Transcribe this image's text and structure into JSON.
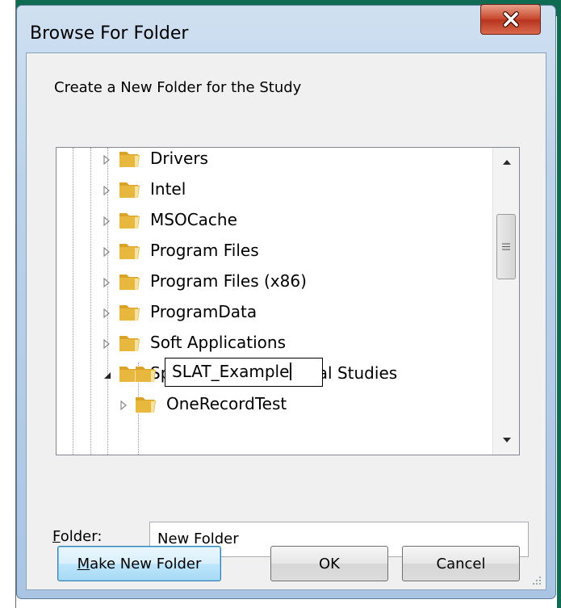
{
  "dialog": {
    "title": "Browse For Folder",
    "prompt": "Create a New Folder for the Study"
  },
  "tree": {
    "items": [
      {
        "label": "Drivers",
        "expander": "collapsed"
      },
      {
        "label": "Intel",
        "expander": "collapsed"
      },
      {
        "label": "MSOCache",
        "expander": "collapsed"
      },
      {
        "label": "Program Files",
        "expander": "collapsed"
      },
      {
        "label": "Program Files (x86)",
        "expander": "collapsed"
      },
      {
        "label": "ProgramData",
        "expander": "collapsed"
      },
      {
        "label": "Soft Applications",
        "expander": "collapsed"
      },
      {
        "label": "Speed_Limit_Appraisal Studies",
        "expander": "expanded"
      },
      {
        "label": "SLAT_Example",
        "expander": "none",
        "editing": true
      },
      {
        "label": "OneRecordTest",
        "expander": "collapsed"
      }
    ]
  },
  "folder": {
    "label_prefix": "F",
    "label_rest": "older:",
    "value": "New Folder"
  },
  "buttons": {
    "make_new_prefix": "M",
    "make_new_rest": "ake New Folder",
    "ok": "OK",
    "cancel": "Cancel"
  },
  "colors": {
    "folder": "#e7b73e",
    "close_button": "#c8492f",
    "window_frame": "#bcd2ea",
    "background_band": "#0f6b52"
  },
  "icons": [
    "close-icon",
    "folder-icon",
    "expand-arrow-icon",
    "scroll-up-icon",
    "scroll-down-icon",
    "size-grip-icon"
  ]
}
